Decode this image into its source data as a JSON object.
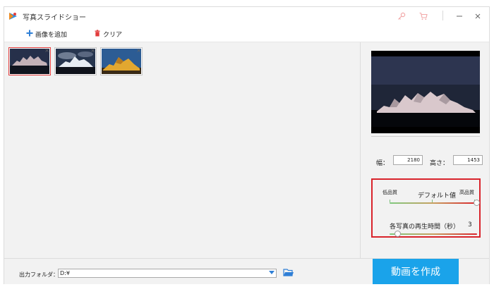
{
  "window": {
    "title": "写真スライドショー"
  },
  "toolbar": {
    "add_image_label": "画像を追加",
    "clear_label": "クリア"
  },
  "thumbnails": [
    {
      "id": "photo-1",
      "selected": true,
      "close_glyph": "×"
    },
    {
      "id": "photo-2",
      "selected": false,
      "close_glyph": "×"
    },
    {
      "id": "photo-3",
      "selected": false,
      "close_glyph": "×"
    }
  ],
  "dimensions": {
    "width_label": "幅：",
    "width_value": "2180",
    "height_label": "高さ：",
    "height_value": "1453"
  },
  "quality": {
    "low_label": "低品質",
    "high_label": "高品質",
    "default_label": "デフォルト値",
    "level": 1.0
  },
  "duration": {
    "label": "各写真の再生時間（秒）",
    "value": "3",
    "level": 0.1
  },
  "output": {
    "folder_label": "出力フォルダ：",
    "folder_value": "D:¥"
  },
  "create_button_label": "動画を作成",
  "colors": {
    "accent_blue": "#1aa3ea",
    "highlight_red": "#d9232b",
    "selected_thumb_border": "#e23c3c"
  },
  "icons": {
    "app": "slideshow-logo-icon",
    "key": "key-icon",
    "cart": "cart-icon",
    "minimize": "minimize-icon",
    "close": "close-icon",
    "add": "plus-icon",
    "clear": "trash-icon",
    "folder": "folder-icon",
    "dropdown": "chevron-down-icon"
  }
}
